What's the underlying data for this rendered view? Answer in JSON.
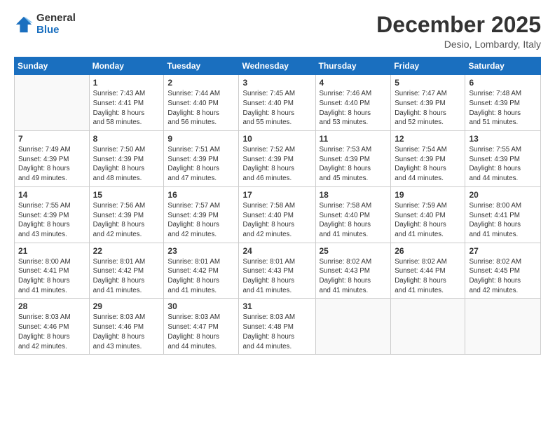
{
  "logo": {
    "general": "General",
    "blue": "Blue"
  },
  "title": "December 2025",
  "location": "Desio, Lombardy, Italy",
  "days_header": [
    "Sunday",
    "Monday",
    "Tuesday",
    "Wednesday",
    "Thursday",
    "Friday",
    "Saturday"
  ],
  "weeks": [
    [
      {
        "num": "",
        "info": ""
      },
      {
        "num": "1",
        "info": "Sunrise: 7:43 AM\nSunset: 4:41 PM\nDaylight: 8 hours\nand 58 minutes."
      },
      {
        "num": "2",
        "info": "Sunrise: 7:44 AM\nSunset: 4:40 PM\nDaylight: 8 hours\nand 56 minutes."
      },
      {
        "num": "3",
        "info": "Sunrise: 7:45 AM\nSunset: 4:40 PM\nDaylight: 8 hours\nand 55 minutes."
      },
      {
        "num": "4",
        "info": "Sunrise: 7:46 AM\nSunset: 4:40 PM\nDaylight: 8 hours\nand 53 minutes."
      },
      {
        "num": "5",
        "info": "Sunrise: 7:47 AM\nSunset: 4:39 PM\nDaylight: 8 hours\nand 52 minutes."
      },
      {
        "num": "6",
        "info": "Sunrise: 7:48 AM\nSunset: 4:39 PM\nDaylight: 8 hours\nand 51 minutes."
      }
    ],
    [
      {
        "num": "7",
        "info": "Sunrise: 7:49 AM\nSunset: 4:39 PM\nDaylight: 8 hours\nand 49 minutes."
      },
      {
        "num": "8",
        "info": "Sunrise: 7:50 AM\nSunset: 4:39 PM\nDaylight: 8 hours\nand 48 minutes."
      },
      {
        "num": "9",
        "info": "Sunrise: 7:51 AM\nSunset: 4:39 PM\nDaylight: 8 hours\nand 47 minutes."
      },
      {
        "num": "10",
        "info": "Sunrise: 7:52 AM\nSunset: 4:39 PM\nDaylight: 8 hours\nand 46 minutes."
      },
      {
        "num": "11",
        "info": "Sunrise: 7:53 AM\nSunset: 4:39 PM\nDaylight: 8 hours\nand 45 minutes."
      },
      {
        "num": "12",
        "info": "Sunrise: 7:54 AM\nSunset: 4:39 PM\nDaylight: 8 hours\nand 44 minutes."
      },
      {
        "num": "13",
        "info": "Sunrise: 7:55 AM\nSunset: 4:39 PM\nDaylight: 8 hours\nand 44 minutes."
      }
    ],
    [
      {
        "num": "14",
        "info": "Sunrise: 7:55 AM\nSunset: 4:39 PM\nDaylight: 8 hours\nand 43 minutes."
      },
      {
        "num": "15",
        "info": "Sunrise: 7:56 AM\nSunset: 4:39 PM\nDaylight: 8 hours\nand 42 minutes."
      },
      {
        "num": "16",
        "info": "Sunrise: 7:57 AM\nSunset: 4:39 PM\nDaylight: 8 hours\nand 42 minutes."
      },
      {
        "num": "17",
        "info": "Sunrise: 7:58 AM\nSunset: 4:40 PM\nDaylight: 8 hours\nand 42 minutes."
      },
      {
        "num": "18",
        "info": "Sunrise: 7:58 AM\nSunset: 4:40 PM\nDaylight: 8 hours\nand 41 minutes."
      },
      {
        "num": "19",
        "info": "Sunrise: 7:59 AM\nSunset: 4:40 PM\nDaylight: 8 hours\nand 41 minutes."
      },
      {
        "num": "20",
        "info": "Sunrise: 8:00 AM\nSunset: 4:41 PM\nDaylight: 8 hours\nand 41 minutes."
      }
    ],
    [
      {
        "num": "21",
        "info": "Sunrise: 8:00 AM\nSunset: 4:41 PM\nDaylight: 8 hours\nand 41 minutes."
      },
      {
        "num": "22",
        "info": "Sunrise: 8:01 AM\nSunset: 4:42 PM\nDaylight: 8 hours\nand 41 minutes."
      },
      {
        "num": "23",
        "info": "Sunrise: 8:01 AM\nSunset: 4:42 PM\nDaylight: 8 hours\nand 41 minutes."
      },
      {
        "num": "24",
        "info": "Sunrise: 8:01 AM\nSunset: 4:43 PM\nDaylight: 8 hours\nand 41 minutes."
      },
      {
        "num": "25",
        "info": "Sunrise: 8:02 AM\nSunset: 4:43 PM\nDaylight: 8 hours\nand 41 minutes."
      },
      {
        "num": "26",
        "info": "Sunrise: 8:02 AM\nSunset: 4:44 PM\nDaylight: 8 hours\nand 41 minutes."
      },
      {
        "num": "27",
        "info": "Sunrise: 8:02 AM\nSunset: 4:45 PM\nDaylight: 8 hours\nand 42 minutes."
      }
    ],
    [
      {
        "num": "28",
        "info": "Sunrise: 8:03 AM\nSunset: 4:46 PM\nDaylight: 8 hours\nand 42 minutes."
      },
      {
        "num": "29",
        "info": "Sunrise: 8:03 AM\nSunset: 4:46 PM\nDaylight: 8 hours\nand 43 minutes."
      },
      {
        "num": "30",
        "info": "Sunrise: 8:03 AM\nSunset: 4:47 PM\nDaylight: 8 hours\nand 44 minutes."
      },
      {
        "num": "31",
        "info": "Sunrise: 8:03 AM\nSunset: 4:48 PM\nDaylight: 8 hours\nand 44 minutes."
      },
      {
        "num": "",
        "info": ""
      },
      {
        "num": "",
        "info": ""
      },
      {
        "num": "",
        "info": ""
      }
    ]
  ]
}
